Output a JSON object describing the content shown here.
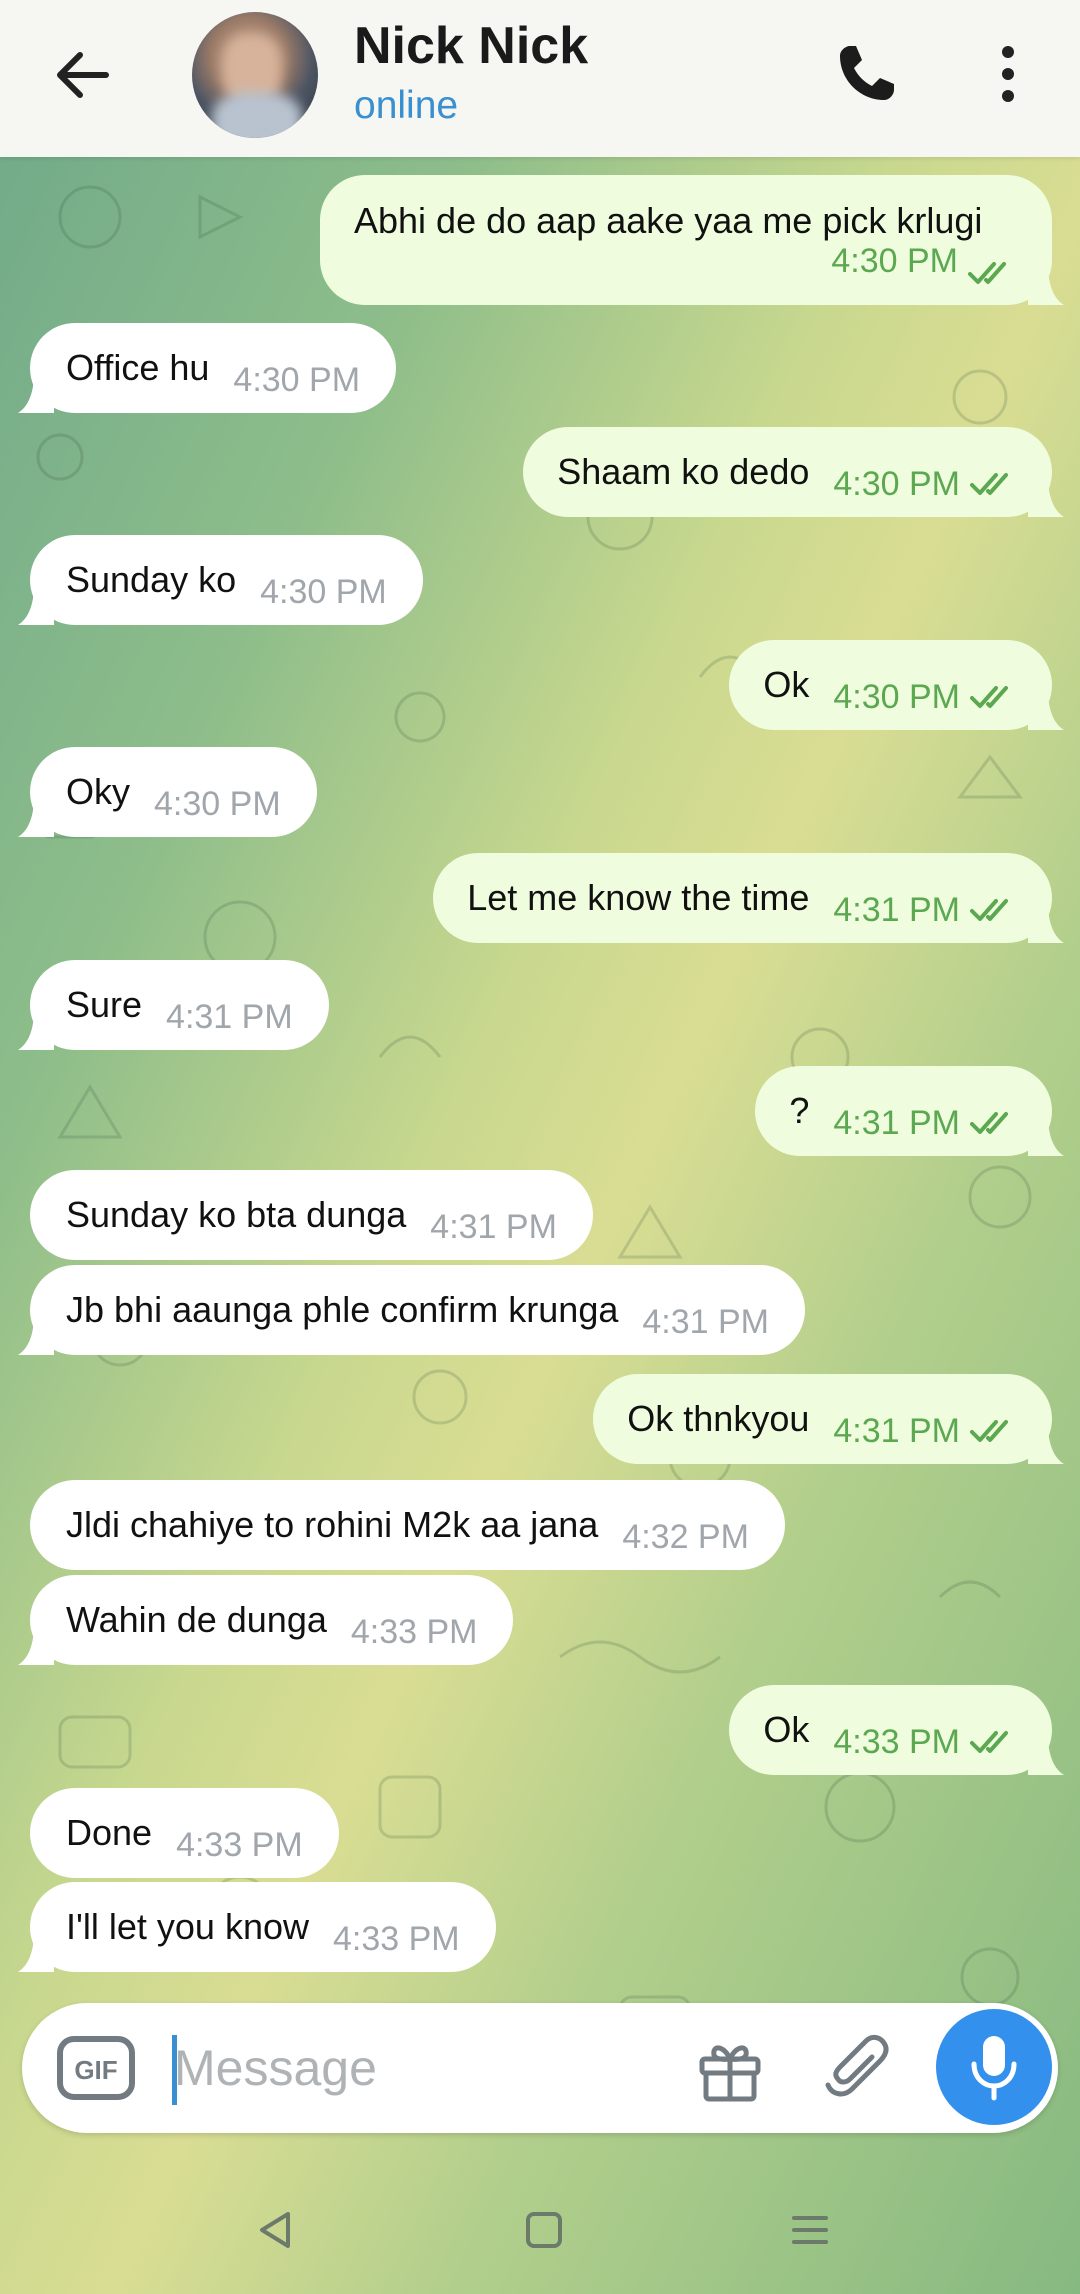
{
  "header": {
    "contact_name": "Nick Nick",
    "status": "online"
  },
  "messages": [
    {
      "dir": "out",
      "text": "Abhi de do aap aake yaa me pick krlugi",
      "time": "4:30 PM"
    },
    {
      "dir": "in",
      "text": "Office hu",
      "time": "4:30 PM"
    },
    {
      "dir": "out",
      "text": "Shaam ko dedo",
      "time": "4:30 PM"
    },
    {
      "dir": "in",
      "text": "Sunday ko",
      "time": "4:30 PM"
    },
    {
      "dir": "out",
      "text": "Ok",
      "time": "4:30 PM"
    },
    {
      "dir": "in",
      "text": "Oky",
      "time": "4:30 PM"
    },
    {
      "dir": "out",
      "text": "Let me know the time",
      "time": "4:31 PM"
    },
    {
      "dir": "in",
      "text": "Sure",
      "time": "4:31 PM"
    },
    {
      "dir": "out",
      "text": "?",
      "time": "4:31 PM"
    },
    {
      "dir": "in",
      "text": "Sunday ko bta dunga",
      "time": "4:31 PM"
    },
    {
      "dir": "in",
      "text": "Jb bhi aaunga phle confirm krunga",
      "time": "4:31 PM"
    },
    {
      "dir": "out",
      "text": "Ok thnkyou",
      "time": "4:31 PM"
    },
    {
      "dir": "in",
      "text": "Jldi chahiye to rohini M2k aa jana",
      "time": "4:32 PM"
    },
    {
      "dir": "in",
      "text": "Wahin de dunga",
      "time": "4:33 PM"
    },
    {
      "dir": "out",
      "text": "Ok",
      "time": "4:33 PM"
    },
    {
      "dir": "in",
      "text": "Done",
      "time": "4:33 PM"
    },
    {
      "dir": "in",
      "text": "I'll let you know",
      "time": "4:33 PM"
    }
  ],
  "composer": {
    "placeholder": "Message",
    "value": ""
  },
  "colors": {
    "incoming_bubble": "#ffffff",
    "outgoing_bubble": "#effdde",
    "outgoing_time": "#5ba851",
    "accent": "#3390ec"
  },
  "icons": {
    "back": "back-arrow-icon",
    "call": "phone-icon",
    "menu": "more-vertical-icon",
    "gif": "gif-icon",
    "gift": "gift-icon",
    "attach": "paperclip-icon",
    "mic": "microphone-icon",
    "read": "double-check-icon"
  }
}
